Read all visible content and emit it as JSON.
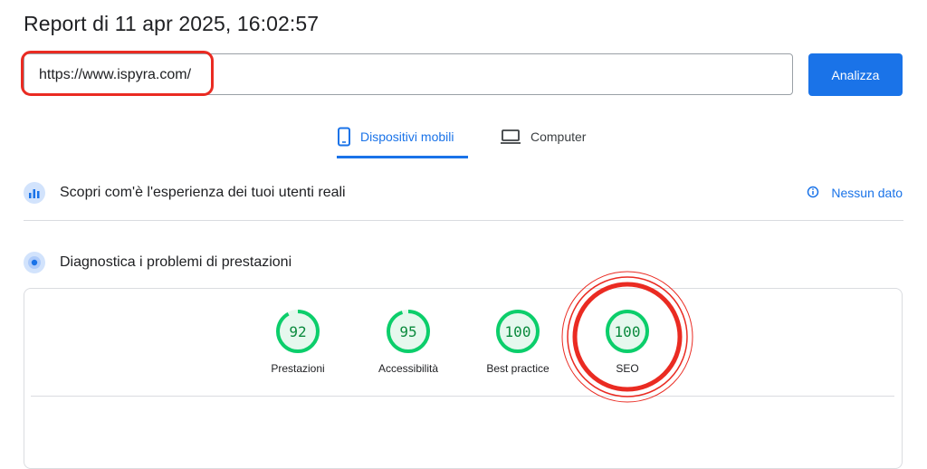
{
  "header": {
    "title": "Report di 11 apr 2025, 16:02:57"
  },
  "url_input": {
    "value": "https://www.ispyra.com/"
  },
  "analyze_button": {
    "label": "Analizza"
  },
  "tabs": [
    {
      "label": "Dispositivi mobili",
      "icon": "smartphone-icon",
      "active": true
    },
    {
      "label": "Computer",
      "icon": "laptop-icon",
      "active": false
    }
  ],
  "field_data": {
    "title": "Scopri com'è l'esperienza dei tuoi utenti reali",
    "icon": "users-chart-icon",
    "status": {
      "label": "Nessun dato",
      "icon": "info-icon"
    }
  },
  "lab_data": {
    "title": "Diagnostica i problemi di prestazioni",
    "icon": "lighthouse-icon",
    "scores": [
      {
        "label": "Prestazioni",
        "value": "92",
        "fraction": 0.92
      },
      {
        "label": "Accessibilità",
        "value": "95",
        "fraction": 0.95
      },
      {
        "label": "Best practice",
        "value": "100",
        "fraction": 1.0
      },
      {
        "label": "SEO",
        "value": "100",
        "fraction": 1.0
      }
    ]
  },
  "colors": {
    "accent": "#1a73e8",
    "pass": "#0cce6b",
    "pass_text": "#0a8a3d",
    "pass_fill": "#e6f8ee",
    "annotation_red": "#ea2b22"
  }
}
